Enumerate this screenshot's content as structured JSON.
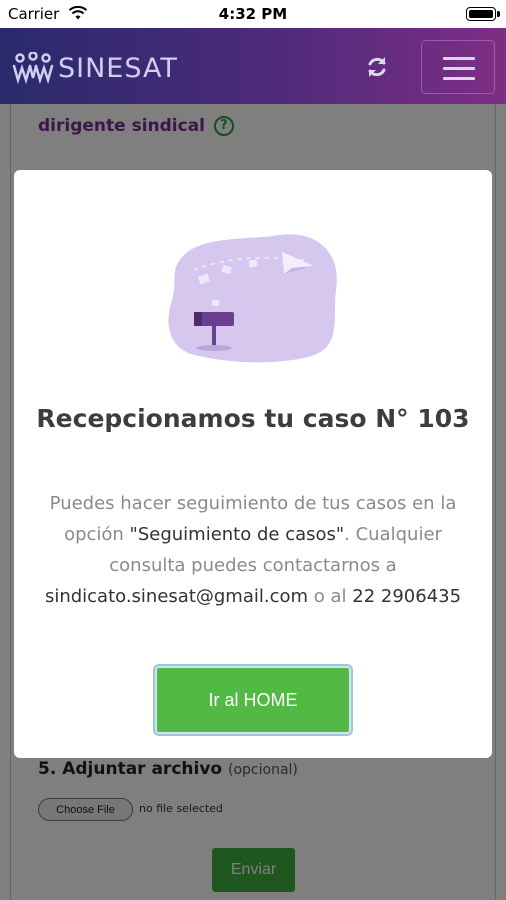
{
  "status_bar": {
    "carrier": "Carrier",
    "time": "4:32 PM"
  },
  "app_bar": {
    "brand": "SINESAT",
    "icons": [
      "people-logo-icon",
      "refresh-icon",
      "hamburger-menu-icon"
    ],
    "gradient_colors": [
      "#2a2a6c",
      "#7d2e85"
    ]
  },
  "page": {
    "partial_label": "dirigente sindical",
    "field5_label": "5. Adjuntar archivo",
    "field5_optional": "(opcional)",
    "choose_file_label": "Choose File",
    "file_status": "no file selected",
    "submit_label": "Enviar"
  },
  "modal": {
    "title": "Recepcionamos tu caso N° 103",
    "body_line1": "Puedes hacer seguimiento de tus casos en la opción ",
    "body_option": "\"Seguimiento de casos\"",
    "body_line2": ". Cualquier consulta puedes contactarnos a ",
    "email": "sindicato.sinesat@gmail.com",
    "body_or": " o al ",
    "phone": "22 2906435",
    "home_button": "Ir al HOME",
    "accent_color": "#52b944",
    "illustration_color": "#c9b6e4"
  }
}
